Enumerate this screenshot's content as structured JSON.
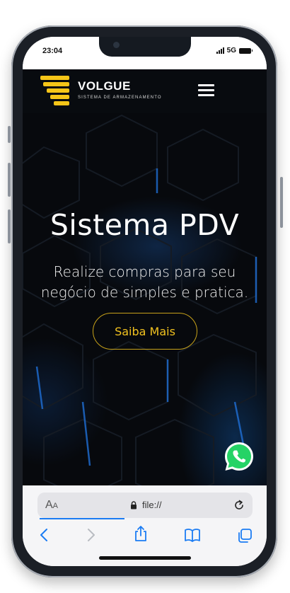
{
  "status_bar": {
    "time": "23:04",
    "network": "5G"
  },
  "navbar": {
    "brand_name": "VOLGUE",
    "brand_tagline": "SISTEMA DE ARMAZENAMENTO",
    "menu_icon": "hamburger-menu-icon",
    "logo_color": "#f5c518"
  },
  "hero": {
    "title": "Sistema PDV",
    "subtitle": "Realize compras para seu negócio de simples e pratica.",
    "cta_label": "Saiba Mais",
    "accent_color": "#f2c21f"
  },
  "floating": {
    "whatsapp_icon": "whatsapp-icon",
    "whatsapp_color": "#25d366"
  },
  "browser": {
    "text_size_label": "AA",
    "url": "file://",
    "lock_icon": "lock-icon",
    "reload_icon": "reload-icon",
    "toolbar": [
      "back-icon",
      "forward-icon",
      "share-icon",
      "bookmarks-icon",
      "tabs-icon"
    ],
    "accent_color": "#1b7cf3"
  }
}
